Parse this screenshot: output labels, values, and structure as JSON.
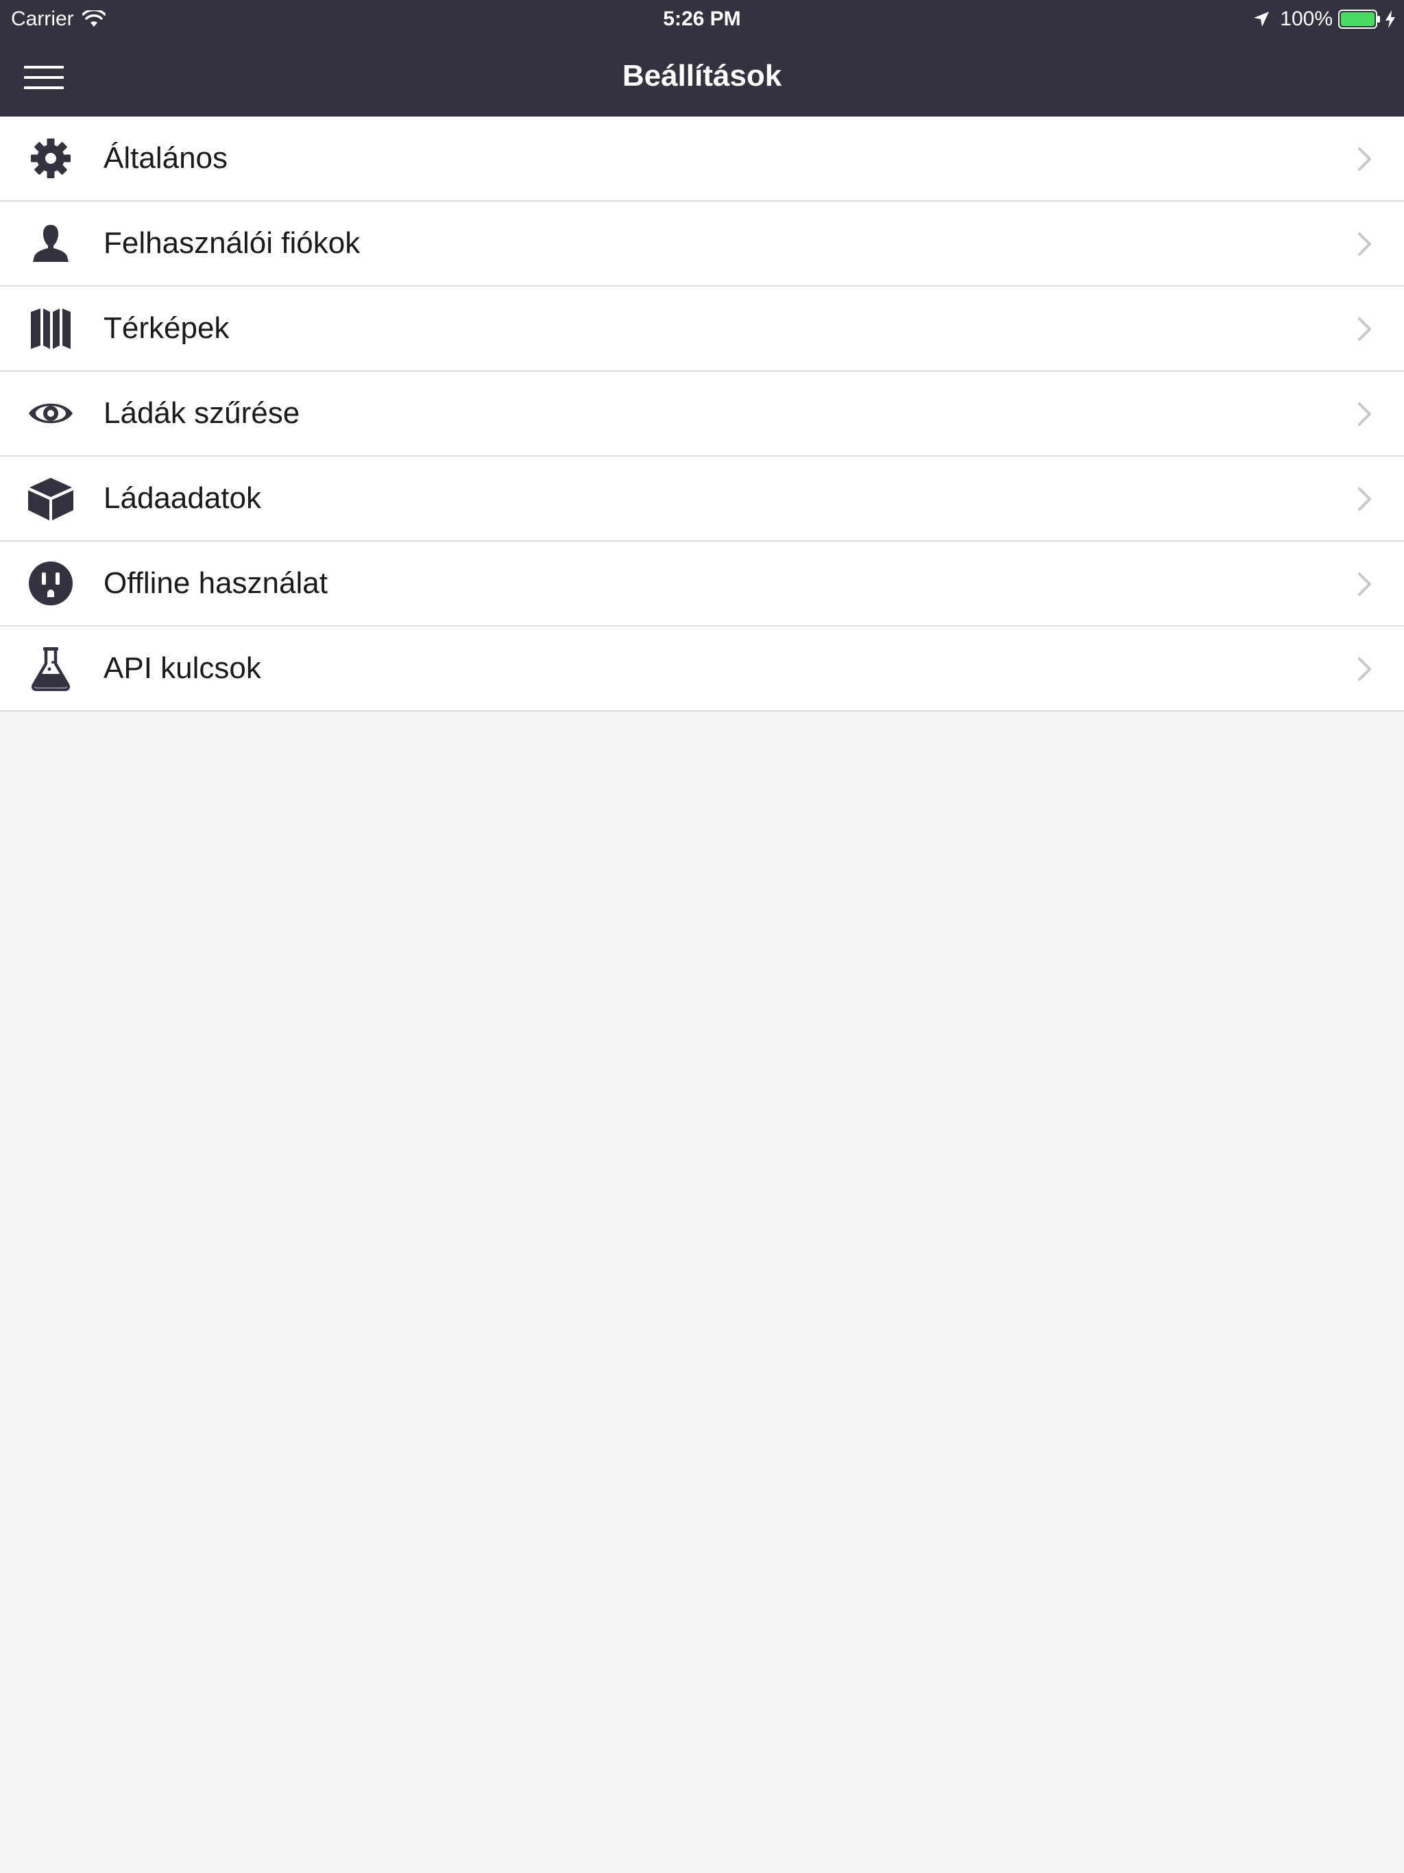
{
  "status_bar": {
    "carrier": "Carrier",
    "time": "5:26 PM",
    "battery_percent": "100%",
    "battery_level": 1.0,
    "icons": [
      "wifi-icon",
      "location-icon",
      "battery-icon",
      "bolt-icon"
    ]
  },
  "nav_bar": {
    "title": "Beállítások",
    "menu_icon": "menu-icon"
  },
  "settings": {
    "items": [
      {
        "label": "Általános",
        "icon": "gear-icon"
      },
      {
        "label": "Felhasználói fiókok",
        "icon": "user-icon"
      },
      {
        "label": "Térképek",
        "icon": "map-icon"
      },
      {
        "label": "Ládák szűrése",
        "icon": "eye-icon"
      },
      {
        "label": "Ládaadatok",
        "icon": "cube-icon"
      },
      {
        "label": "Offline használat",
        "icon": "outlet-icon"
      },
      {
        "label": "API kulcsok",
        "icon": "flask-icon"
      }
    ],
    "accessory_icon": "chevron-right-icon"
  },
  "colors": {
    "header_background": "#333340",
    "icon_color": "#333340",
    "row_background": "#ffffff",
    "page_background": "#f3f3f3",
    "separator": "#dcdcdc",
    "chevron": "#c7c7cc",
    "battery_fill": "#4cd964"
  }
}
